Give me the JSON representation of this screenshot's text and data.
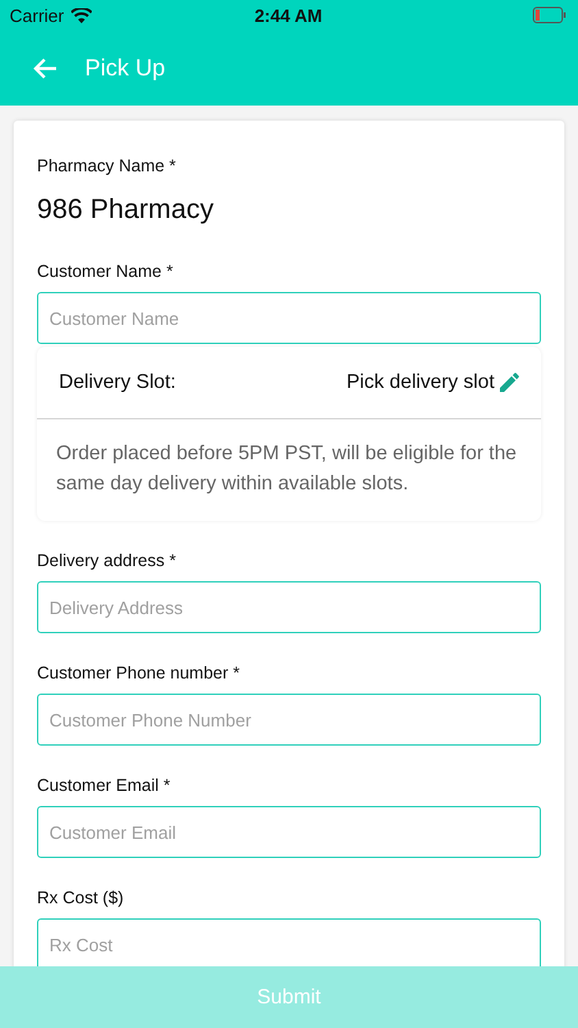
{
  "status_bar": {
    "carrier": "Carrier",
    "time": "2:44 AM"
  },
  "header": {
    "title": "Pick Up"
  },
  "pharmacy": {
    "label": "Pharmacy Name *",
    "value": "986 Pharmacy"
  },
  "customer_name": {
    "label": "Customer Name *",
    "placeholder": "Customer Name"
  },
  "delivery_slot": {
    "label": "Delivery Slot:",
    "action": "Pick delivery slot",
    "note": "Order placed before 5PM PST, will be eligible for the same day delivery within available slots."
  },
  "fields": [
    {
      "label": "Delivery address *",
      "placeholder": "Delivery Address"
    },
    {
      "label": "Customer Phone number *",
      "placeholder": "Customer Phone Number"
    },
    {
      "label": "Customer Email *",
      "placeholder": "Customer Email"
    },
    {
      "label": "Rx Cost ($)",
      "placeholder": "Rx Cost"
    }
  ],
  "submit": {
    "label": "Submit",
    "disabled": true
  }
}
